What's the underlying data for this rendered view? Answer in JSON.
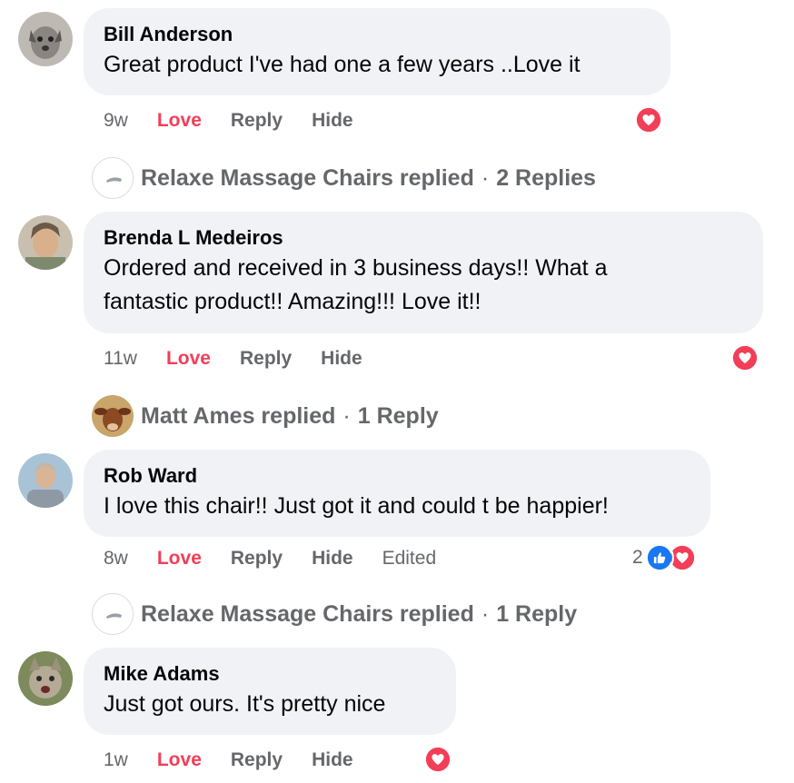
{
  "comments": [
    {
      "author": "Bill Anderson",
      "text": "Great product I've had one a few years ..Love it",
      "time": "9w",
      "love_label": "Love",
      "reply_label": "Reply",
      "hide_label": "Hide",
      "reactions": [
        "love"
      ],
      "reply_summary": {
        "actor": "Relaxe Massage Chairs replied",
        "separator": "·",
        "count_label": "2 Replies"
      }
    },
    {
      "author": "Brenda L Medeiros",
      "text_lines": [
        "Ordered and received in 3 business days!! What a",
        "fantastic product!! Amazing!!! Love it!!"
      ],
      "time": "11w",
      "love_label": "Love",
      "reply_label": "Reply",
      "hide_label": "Hide",
      "reactions": [
        "love"
      ],
      "reply_summary": {
        "actor": "Matt Ames replied",
        "separator": "·",
        "count_label": "1 Reply"
      }
    },
    {
      "author": "Rob Ward",
      "text": "I love this chair!! Just got it and could t be happier!",
      "time": "8w",
      "love_label": "Love",
      "reply_label": "Reply",
      "hide_label": "Hide",
      "edited_label": "Edited",
      "reaction_count": "2",
      "reactions": [
        "like",
        "love"
      ],
      "reply_summary": {
        "actor": "Relaxe Massage Chairs replied",
        "separator": "·",
        "count_label": "1 Reply"
      }
    },
    {
      "author": "Mike Adams",
      "text": "Just got ours. It's pretty nice",
      "time": "1w",
      "love_label": "Love",
      "reply_label": "Reply",
      "hide_label": "Hide",
      "reactions": [
        "love"
      ]
    }
  ],
  "colors": {
    "bubble": "#f0f2f5",
    "love": "#f33e58",
    "like": "#1877f2",
    "secondary_text": "#65676b"
  }
}
